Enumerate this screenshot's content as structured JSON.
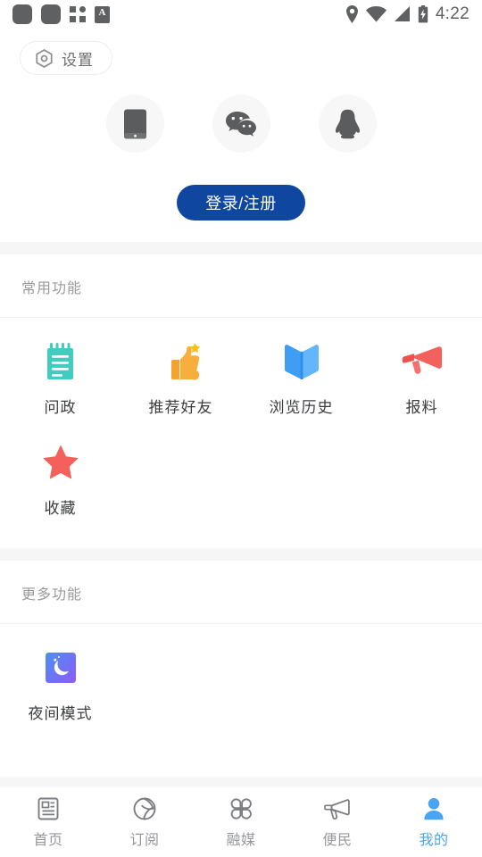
{
  "statusbar": {
    "time": "4:22",
    "left_icons": [
      "rounded-square-icon",
      "rounded-square-icon",
      "app-grid-icon",
      "a-badge-icon"
    ],
    "right_icons": [
      "location-pin-icon",
      "wifi-icon",
      "cellular-signal-icon",
      "battery-charging-icon"
    ],
    "icon_color": "#5f6061",
    "a_badge_text": "A"
  },
  "header": {
    "settings_label": "设置",
    "settings_icon": "hexagon-gear-icon"
  },
  "login": {
    "methods": [
      {
        "name": "phone-login",
        "icon": "mobile-phone-icon"
      },
      {
        "name": "wechat-login",
        "icon": "wechat-icon"
      },
      {
        "name": "qq-login",
        "icon": "qq-penguin-icon"
      }
    ],
    "button_label": "登录/注册",
    "button_color": "#0f47a0"
  },
  "sections": [
    {
      "title": "常用功能",
      "items": [
        {
          "label": "问政",
          "icon": "notepad-icon",
          "color": "#3fcdbf"
        },
        {
          "label": "推荐好友",
          "icon": "thumbs-up-star-icon",
          "color": "#f5a32a"
        },
        {
          "label": "浏览历史",
          "icon": "open-book-icon",
          "color": "#43a5f5"
        },
        {
          "label": "报料",
          "icon": "megaphone-icon",
          "color": "#f4605c"
        },
        {
          "label": "收藏",
          "icon": "star-icon",
          "color": "#f4605c"
        }
      ]
    },
    {
      "title": "更多功能",
      "items": [
        {
          "label": "夜间模式",
          "icon": "night-mode-moon-icon",
          "color": "#6f6bf0"
        }
      ]
    }
  ],
  "bottom_nav": {
    "active_color": "#49a5f1",
    "inactive_color": "#95979a",
    "items": [
      {
        "label": "首页",
        "icon": "newspaper-icon",
        "active": false
      },
      {
        "label": "订阅",
        "icon": "globe-subscribe-icon",
        "active": false
      },
      {
        "label": "融媒",
        "icon": "four-petal-clover-icon",
        "active": false
      },
      {
        "label": "便民",
        "icon": "megaphone-outline-icon",
        "active": false
      },
      {
        "label": "我的",
        "icon": "person-icon",
        "active": true
      }
    ]
  }
}
